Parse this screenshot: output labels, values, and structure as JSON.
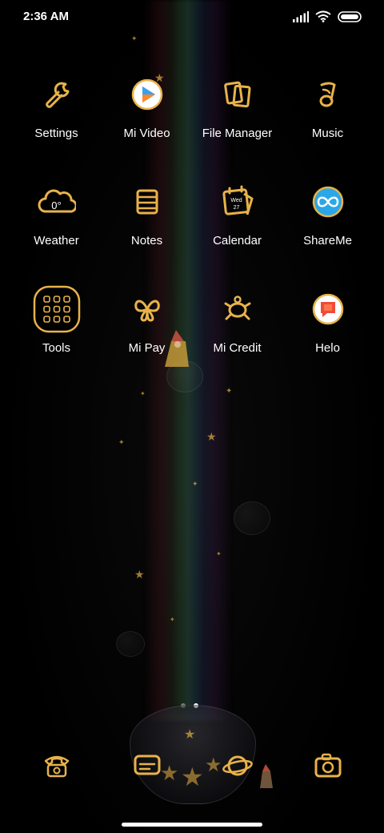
{
  "status_bar": {
    "time": "2:36 AM",
    "icons": [
      "signal-icon",
      "wifi-icon",
      "battery-icon"
    ]
  },
  "apps": [
    {
      "label": "Settings",
      "icon": "wrench-icon"
    },
    {
      "label": "Mi Video",
      "icon": "play-icon"
    },
    {
      "label": "File Manager",
      "icon": "folder-icon"
    },
    {
      "label": "Music",
      "icon": "music-note-icon"
    },
    {
      "label": "Weather",
      "icon": "cloud-icon",
      "icon_text": "0°"
    },
    {
      "label": "Notes",
      "icon": "notes-icon"
    },
    {
      "label": "Calendar",
      "icon": "calendar-icon",
      "icon_text": "Wed",
      "icon_subtext": "27"
    },
    {
      "label": "ShareMe",
      "icon": "infinity-icon"
    },
    {
      "label": "Tools",
      "icon": "tools-folder-icon"
    },
    {
      "label": "Mi Pay",
      "icon": "butterfly-icon"
    },
    {
      "label": "Mi Credit",
      "icon": "turtle-icon"
    },
    {
      "label": "Helo",
      "icon": "chat-bubble-icon"
    }
  ],
  "page_indicator": {
    "count": 2,
    "active": 1
  },
  "dock": [
    {
      "icon": "phone-icon"
    },
    {
      "icon": "message-icon"
    },
    {
      "icon": "browser-planet-icon"
    },
    {
      "icon": "camera-icon"
    }
  ],
  "colors": {
    "icon_gold": "#e8b24a",
    "icon_gold_dark": "#8a5a12",
    "label_white": "#ffffff",
    "background": "#000000"
  }
}
